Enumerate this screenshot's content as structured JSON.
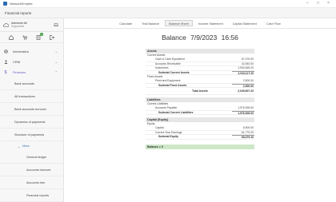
{
  "window": {
    "app_name": "NetworkErmptia"
  },
  "header": {
    "title": "Financial reports"
  },
  "user": {
    "name": "Adminstn All",
    "role": "Supportimir"
  },
  "toolbar": {
    "cart_badge": "1"
  },
  "sidebar": {
    "items": [
      {
        "label": "Information"
      },
      {
        "label": "CRM"
      },
      {
        "label": "Finances"
      }
    ],
    "finances_sub": [
      {
        "label": "Bank accounts"
      },
      {
        "label": "All transactions"
      },
      {
        "label": "Bank accounts turnover"
      },
      {
        "label": "Dynamics of payments"
      },
      {
        "label": "Structure of payments"
      }
    ],
    "more_label": "More",
    "more_sub": [
      {
        "label": "General ledger"
      },
      {
        "label": "Accounts turnover"
      },
      {
        "label": "Accounts tree"
      },
      {
        "label": "Financial reports"
      }
    ]
  },
  "tabs": [
    {
      "label": "Calculate"
    },
    {
      "label": "Trial Balance"
    },
    {
      "label": "Balance Sheet"
    },
    {
      "label": "Income Statement"
    },
    {
      "label": "Capital Statement"
    },
    {
      "label": "Cash Flow"
    }
  ],
  "report": {
    "title_word": "Balance",
    "date": "7/9/2023",
    "time": "16:56",
    "assets": {
      "heading": "Assets",
      "current_label": "Current Assets",
      "current_rows": [
        {
          "label": "Cash & Cash Equivalent",
          "value": "67,076.00"
        },
        {
          "label": "Accounts Receivable",
          "value": "42,540.00"
        },
        {
          "label": "Inventories",
          "value": "1,933,465.20"
        }
      ],
      "subtotal_current_label": "Subtotal Current Assets",
      "subtotal_current_value": "2,043,117.20",
      "fixed_label": "Fixed Assets",
      "fixed_rows": [
        {
          "label": "Plant and Equipment",
          "value": "2,500.00"
        }
      ],
      "subtotal_fixed_label": "Subtotal Fixed Assets",
      "subtotal_fixed_value": "2,500.00",
      "total_label": "Total Assets",
      "total_value": "2,045,607.20"
    },
    "liabilities": {
      "heading": "Liabilities",
      "current_label": "Current Liabilities",
      "rows": [
        {
          "label": "Accounts Payable",
          "value": "1,976,928.00"
        }
      ],
      "subtotal_label": "Subtotal Current Liabilities",
      "subtotal_value": "1,976,928.00"
    },
    "equity": {
      "heading": "Capital (Equity)",
      "group_label": "Equity",
      "rows": [
        {
          "label": "Capital",
          "value": "6,900.00"
        },
        {
          "label": "Current Year Earnings",
          "value": "61,779.20"
        }
      ],
      "subtotal_label": "Subtotal Equity",
      "subtotal_value": "68,679.20"
    },
    "balance_check": "Balance = 0"
  }
}
